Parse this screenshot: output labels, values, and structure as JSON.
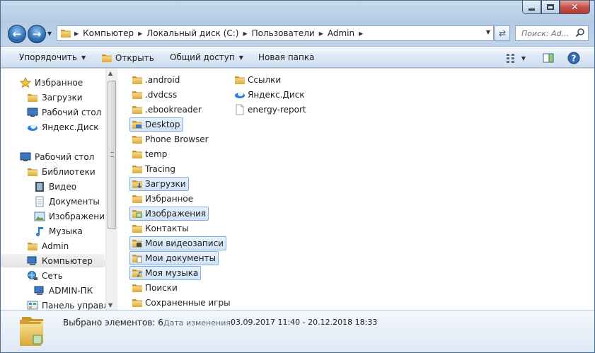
{
  "window": {
    "minimize_icon": "minimize-icon",
    "maximize_icon": "maximize-icon",
    "close_glyph": "✕"
  },
  "address": {
    "segments": [
      "Компьютер",
      "Локальный диск (C:)",
      "Пользователи",
      "Admin"
    ],
    "search_placeholder": "Поиск: Ad..."
  },
  "toolbar": {
    "organize": "Упорядочить",
    "open": "Открыть",
    "share": "Общий доступ",
    "new_folder": "Новая папка"
  },
  "nav": {
    "favorites": "Избранное",
    "downloads": "Загрузки",
    "desktop_fav": "Рабочий стол",
    "yandex_disk": "Яндекс.Диск",
    "desktop": "Рабочий стол",
    "libraries": "Библиотеки",
    "video": "Видео",
    "documents": "Документы",
    "images": "Изображения",
    "music": "Музыка",
    "admin": "Admin",
    "computer": "Компьютер",
    "network": "Сеть",
    "admin_pc": "ADMIN-ПК",
    "control_panel": "Панель управле"
  },
  "files": {
    "col1": [
      ".android",
      ".dvdcss",
      ".ebookreader",
      "Desktop",
      "Phone Browser",
      "temp",
      "Tracing",
      "Загрузки",
      "Избранное",
      "Изображения",
      "Контакты",
      "Мои видеозаписи",
      "Мои документы",
      "Моя музыка",
      "Поиски",
      "Сохраненные игры"
    ],
    "col2": [
      "Ссылки",
      "Яндекс.Диск",
      "energy-report"
    ]
  },
  "details": {
    "selected_count": "Выбрано элементов: 6",
    "date_label": "Дата изменения:",
    "date_value": "03.09.2017 11:40 - 20.12.2018 18:33"
  },
  "colors": {
    "folder": "#e8c15a",
    "selection": "#cfe3f8",
    "accent": "#2e6db4"
  }
}
